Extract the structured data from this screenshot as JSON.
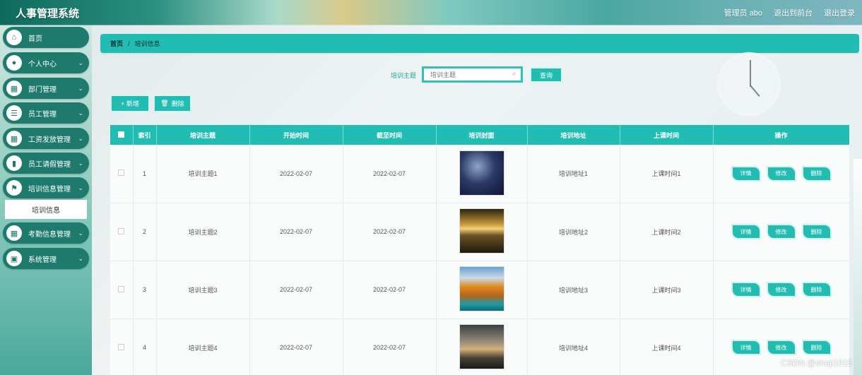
{
  "header": {
    "title": "人事管理系统",
    "user": "管理员 abo",
    "link_front": "退出到前台",
    "link_logout": "退出登录"
  },
  "sidebar": {
    "items": [
      {
        "label": "首页",
        "icon": "home-icon",
        "expandable": false
      },
      {
        "label": "个人中心",
        "icon": "user-icon",
        "expandable": true
      },
      {
        "label": "部门管理",
        "icon": "grid-icon",
        "expandable": true
      },
      {
        "label": "员工管理",
        "icon": "sliders-icon",
        "expandable": true
      },
      {
        "label": "工资发放管理",
        "icon": "grid-icon",
        "expandable": true
      },
      {
        "label": "员工请假管理",
        "icon": "bar-chart-icon",
        "expandable": true
      },
      {
        "label": "培训信息管理",
        "icon": "flag-icon",
        "expandable": true
      },
      {
        "label": "考勤信息管理",
        "icon": "grid-icon",
        "expandable": true
      },
      {
        "label": "系统管理",
        "icon": "clipboard-icon",
        "expandable": true
      }
    ],
    "submenu_label": "培训信息"
  },
  "breadcrumb": {
    "home": "首页",
    "separator": "/",
    "current": "培训信息"
  },
  "search": {
    "label": "培训主题",
    "placeholder": "培训主题",
    "button": "查询"
  },
  "actions": {
    "add": "+ 新增",
    "delete": "删除"
  },
  "table": {
    "headers": [
      "",
      "索引",
      "培训主题",
      "开始时间",
      "截至时间",
      "培训封面",
      "培训地址",
      "上课时间",
      "操作"
    ],
    "rows": [
      {
        "index": "1",
        "topic": "培训主题1",
        "start": "2022-02-07",
        "end": "2022-02-07",
        "cover": "cover-night-sky",
        "address": "培训地址1",
        "class_time": "上课时间1"
      },
      {
        "index": "2",
        "topic": "培训主题2",
        "start": "2022-02-07",
        "end": "2022-02-07",
        "cover": "cover-sunset-beach",
        "address": "培训地址2",
        "class_time": "上课时间2"
      },
      {
        "index": "3",
        "topic": "培训主题3",
        "start": "2022-02-07",
        "end": "2022-02-07",
        "cover": "cover-autumn-lake",
        "address": "培训地址3",
        "class_time": "上课时间3"
      },
      {
        "index": "4",
        "topic": "培训主题4",
        "start": "2022-02-07",
        "end": "2022-02-07",
        "cover": "cover-lone-tree",
        "address": "培训地址4",
        "class_time": "上课时间4"
      }
    ],
    "op_labels": {
      "detail": "详情",
      "edit": "修改",
      "delete": "删除"
    }
  },
  "watermark": "CSDN @sheji1015",
  "colors": {
    "accent": "#22bdb2",
    "sidebar_item": "#1d7a6c"
  }
}
